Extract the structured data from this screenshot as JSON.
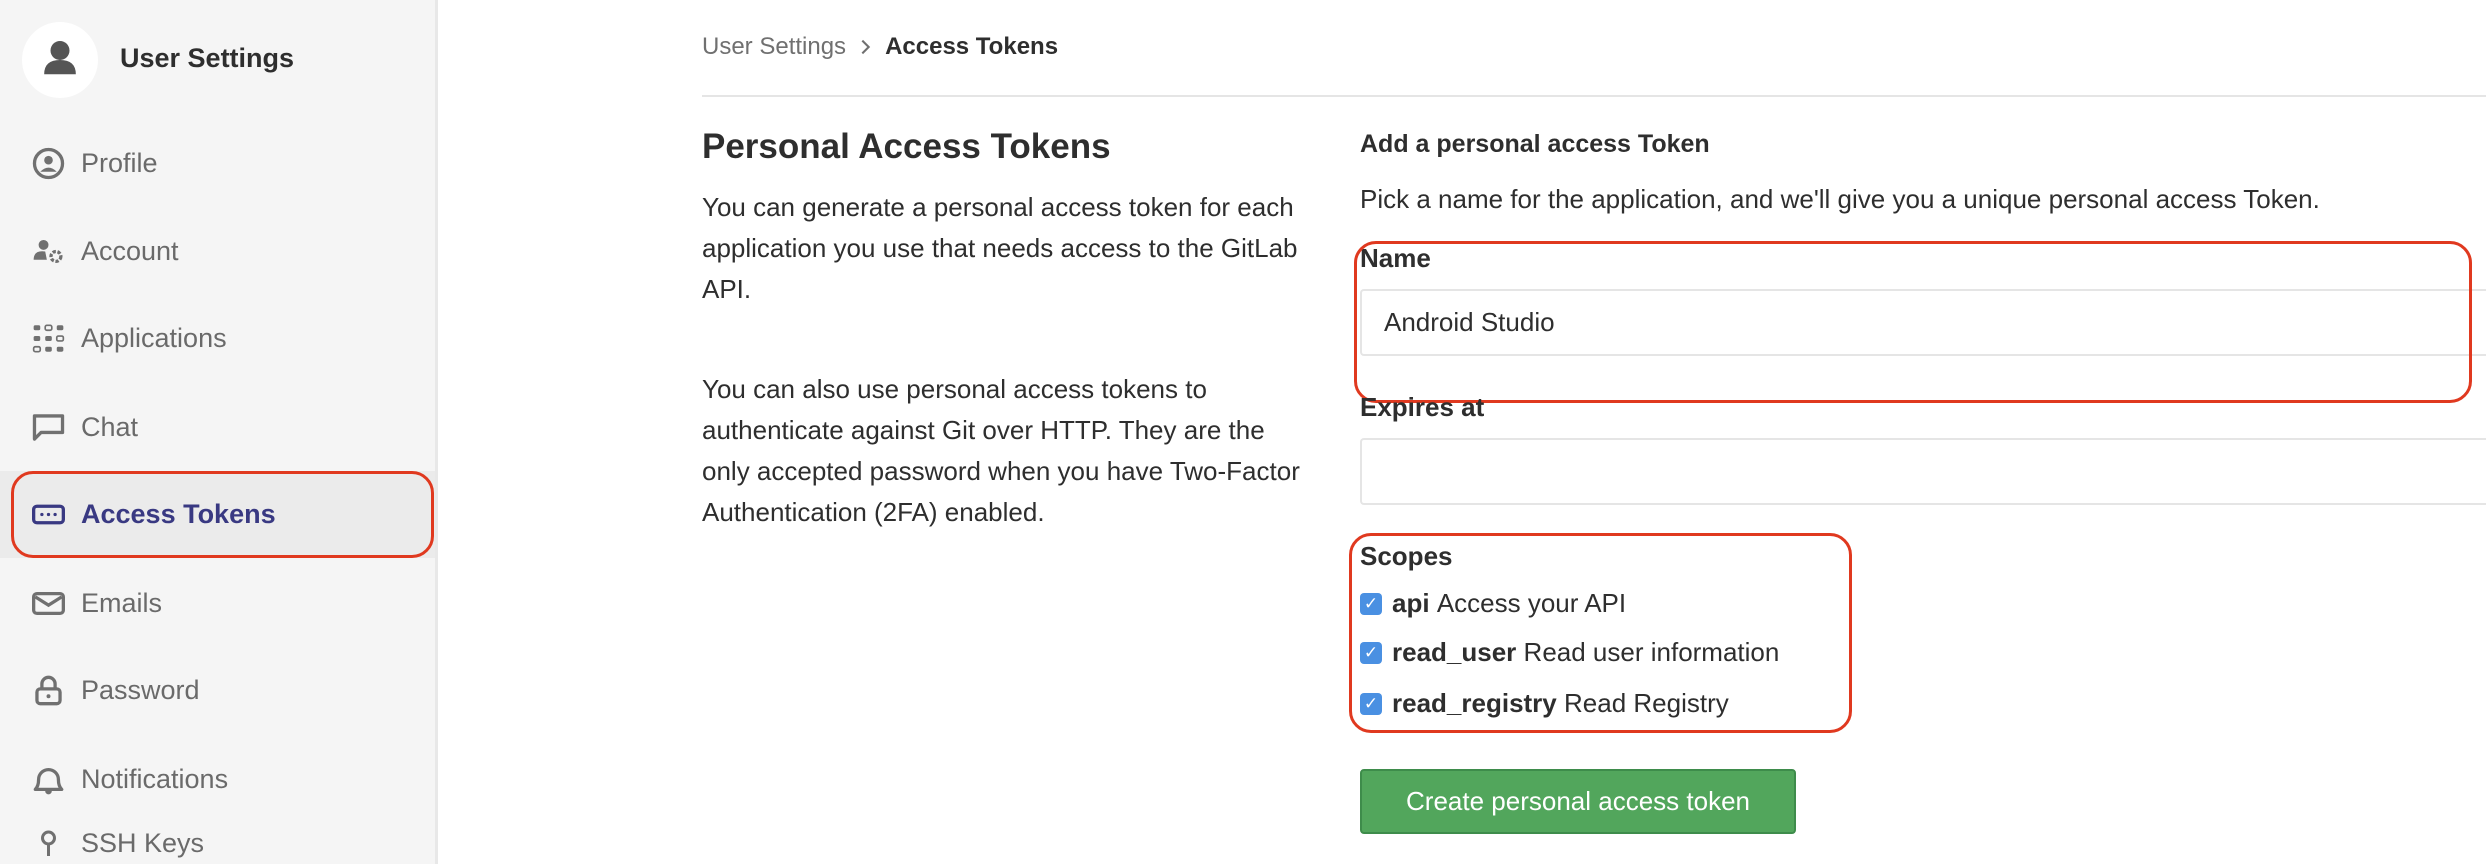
{
  "sidebar": {
    "title": "User Settings",
    "items": [
      {
        "label": "Profile",
        "icon": "profile-icon"
      },
      {
        "label": "Account",
        "icon": "account-icon"
      },
      {
        "label": "Applications",
        "icon": "applications-icon"
      },
      {
        "label": "Chat",
        "icon": "chat-icon"
      },
      {
        "label": "Access Tokens",
        "icon": "token-icon",
        "active": true
      },
      {
        "label": "Emails",
        "icon": "email-icon"
      },
      {
        "label": "Password",
        "icon": "lock-icon"
      },
      {
        "label": "Notifications",
        "icon": "bell-icon"
      },
      {
        "label": "SSH Keys",
        "icon": "key-icon"
      }
    ]
  },
  "breadcrumb": {
    "parent": "User Settings",
    "current": "Access Tokens"
  },
  "intro": {
    "title": "Personal Access Tokens",
    "para1": "You can generate a personal access token for each application you use that needs access to the GitLab API.",
    "para2": "You can also use personal access tokens to authenticate against Git over HTTP. They are the only accepted password when you have Two-Factor Authentication (2FA) enabled."
  },
  "form": {
    "heading": "Add a personal access Token",
    "description": "Pick a name for the application, and we'll give you a unique personal access Token.",
    "name_label": "Name",
    "name_value": "Android Studio",
    "expires_label": "Expires at",
    "expires_value": "",
    "scopes_label": "Scopes",
    "scopes": [
      {
        "name": "api",
        "desc": "Access your API",
        "checked": true
      },
      {
        "name": "read_user",
        "desc": "Read user information",
        "checked": true
      },
      {
        "name": "read_registry",
        "desc": "Read Registry",
        "checked": true
      }
    ],
    "submit_label": "Create personal access token"
  },
  "colors": {
    "accent": "#4b4ba3",
    "highlight": "#e0391f",
    "button": "#52a65c",
    "checkbox": "#4a90e2"
  }
}
